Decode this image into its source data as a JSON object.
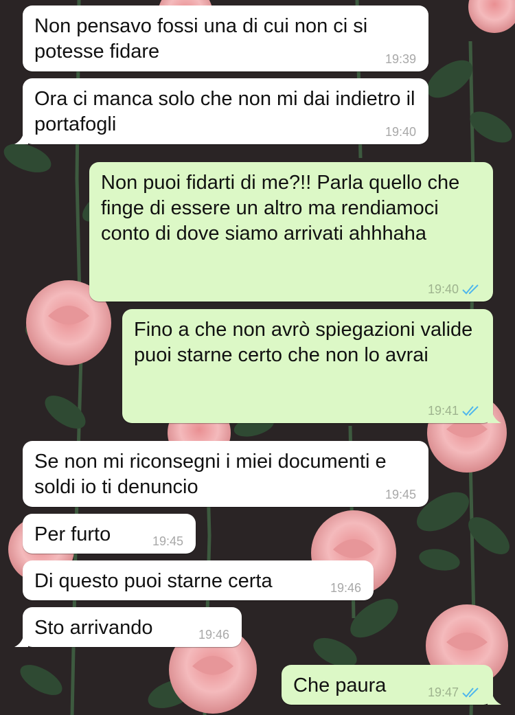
{
  "chat": {
    "messages": [
      {
        "direction": "incoming",
        "text": "Non pensavo fossi una di cui non ci si potesse fidare",
        "time": "19:39"
      },
      {
        "direction": "incoming",
        "text": "Ora ci manca solo che non mi dai indietro il portafogli",
        "time": "19:40"
      },
      {
        "direction": "outgoing",
        "text": "Non puoi fidarti di me?!! Parla quello che finge di essere un altro ma rendiamoci conto di dove siamo arrivati ahhhaha",
        "time": "19:40",
        "status": "read"
      },
      {
        "direction": "outgoing",
        "text": "Fino a che non avrò spiegazioni valide puoi starne certo che non lo avrai",
        "time": "19:41",
        "status": "read"
      },
      {
        "direction": "incoming",
        "text": "Se non mi riconsegni i miei documenti e soldi io ti denuncio",
        "time": "19:45"
      },
      {
        "direction": "incoming",
        "text": "Per furto",
        "time": "19:45"
      },
      {
        "direction": "incoming",
        "text": "Di questo puoi starne certa",
        "time": "19:46"
      },
      {
        "direction": "incoming",
        "text": "Sto arrivando",
        "time": "19:46"
      },
      {
        "direction": "outgoing",
        "text": "Che paura",
        "time": "19:47",
        "status": "read"
      }
    ]
  },
  "theme": {
    "incoming_bubble": "#ffffff",
    "outgoing_bubble": "#dcf8c6",
    "read_tick": "#4fb6ec",
    "wallpaper": "#2a2425",
    "rose_pink": "#f2b3b5",
    "leaf_green": "#2f4a33"
  },
  "icons": {
    "read_receipt": "double-check-icon"
  }
}
